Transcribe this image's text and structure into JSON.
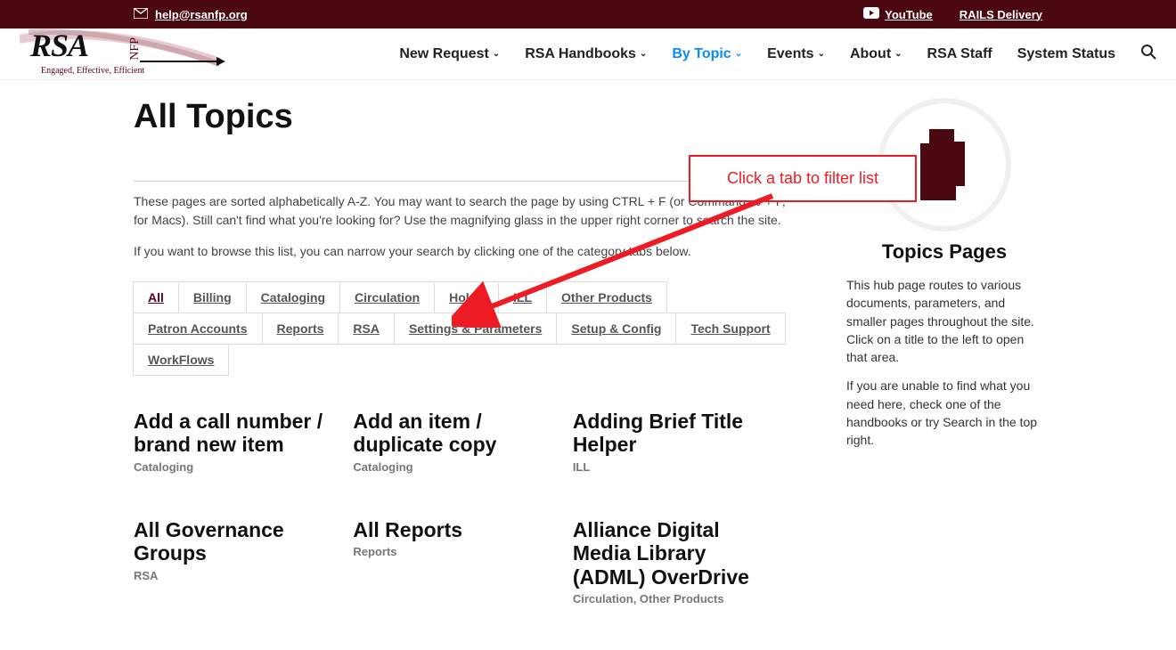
{
  "topbar": {
    "email": "help@rsanfp.org",
    "links": {
      "youtube": "YouTube",
      "rails": "RAILS Delivery"
    }
  },
  "logo": {
    "main": "RSA",
    "nfp": "NFP",
    "tag": "Engaged, Effective, Efficient"
  },
  "nav": {
    "items": [
      {
        "label": "New Request",
        "dd": true,
        "active": false
      },
      {
        "label": "RSA Handbooks",
        "dd": true,
        "active": false
      },
      {
        "label": "By Topic",
        "dd": true,
        "active": true
      },
      {
        "label": "Events",
        "dd": true,
        "active": false
      },
      {
        "label": "About",
        "dd": true,
        "active": false
      },
      {
        "label": "RSA Staff",
        "dd": false,
        "active": false
      },
      {
        "label": "System Status",
        "dd": false,
        "active": false
      }
    ]
  },
  "page": {
    "title": "All Topics",
    "intro1": "These pages are sorted alphabetically A-Z. You may want to search the page by using CTRL + F (or Command ⌘ + F, for Macs). Still can't find what you're looking for? Use the magnifying glass in the upper right corner to search the site.",
    "intro2": "If you want to browse this list, you can narrow your search by clicking one of the category tabs below."
  },
  "tabs": [
    "All",
    "Billing",
    "Cataloging",
    "Circulation",
    "Holds",
    "ILL",
    "Other Products",
    "Patron Accounts",
    "Reports",
    "RSA",
    "Settings & Parameters",
    "Setup & Config",
    "Tech Support",
    "WorkFlows"
  ],
  "active_tab": "All",
  "cards": [
    {
      "title": "Add a call number / brand new item",
      "cat": "Cataloging"
    },
    {
      "title": "Add an item / duplicate copy",
      "cat": "Cataloging"
    },
    {
      "title": "Adding Brief Title Helper",
      "cat": "ILL"
    },
    {
      "title": "All Governance Groups",
      "cat": "RSA"
    },
    {
      "title": "All Reports",
      "cat": "Reports"
    },
    {
      "title": "Alliance Digital Media Library (ADML) OverDrive",
      "cat": "Circulation, Other Products"
    }
  ],
  "sidebar": {
    "title": "Topics Pages",
    "p1": "This hub page routes to various documents, parameters, and smaller pages throughout the site. Click on a title to the left to open that area.",
    "p2": "If you are unable to find what you need here, check one of the handbooks or try Search in the top right."
  },
  "annotation": {
    "text": "Click a tab to filter list"
  }
}
